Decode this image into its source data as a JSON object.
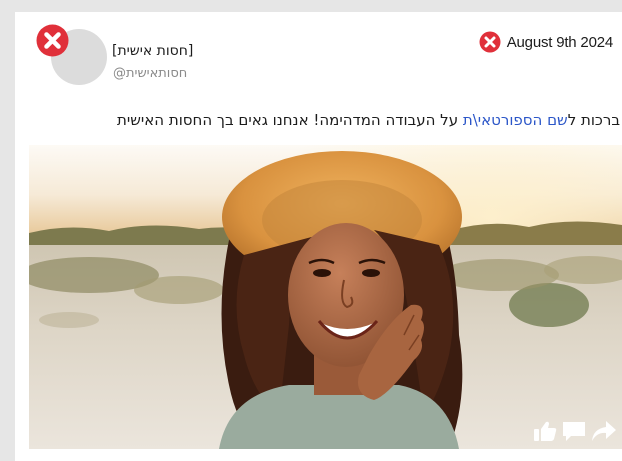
{
  "post": {
    "author_name": "[חסות אישית]",
    "author_handle": "@חסותאישית",
    "date": "August 9th 2024",
    "message_before": "ברכות ל",
    "message_link": "שם הספורטאי\\ת",
    "message_after": " על העבודה המדהימה! אנחנו גאים בך החסות האישית"
  },
  "icons": {
    "close": "close-icon",
    "date_close": "close-icon",
    "like": "thumbs-up-icon",
    "comment": "comment-icon",
    "share": "share-icon"
  },
  "colors": {
    "close_red": "#e0303a",
    "link_blue": "#2b56c8",
    "card_bg": "#ffffff",
    "page_bg": "#e6e6e6"
  }
}
